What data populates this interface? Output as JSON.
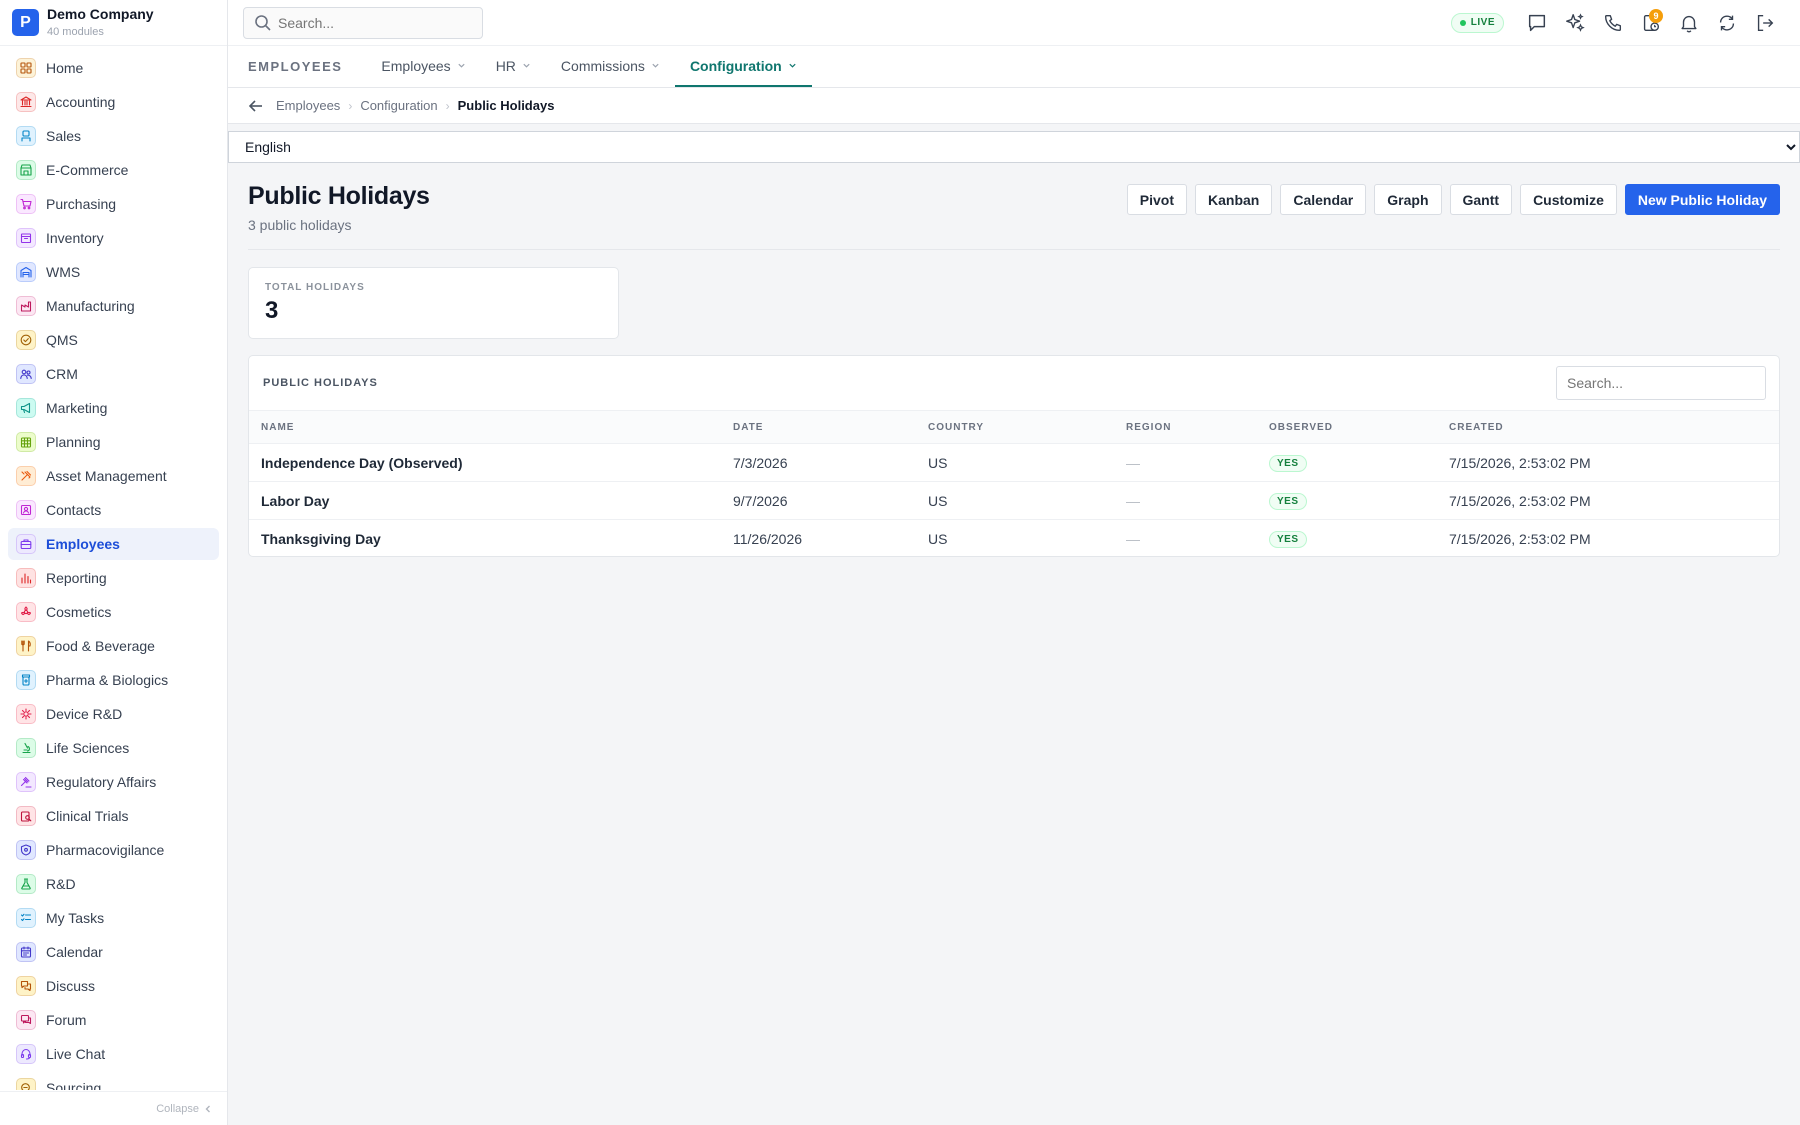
{
  "brand": {
    "logo_letter": "P",
    "name": "Demo Company",
    "subtitle": "40 modules"
  },
  "sidebar": {
    "items": [
      {
        "label": "Home",
        "icon": "grid-icon",
        "color": "#b45309",
        "bg": "#fdf3d8",
        "active": false
      },
      {
        "label": "Accounting",
        "icon": "bank-icon",
        "color": "#dc2626",
        "bg": "#fde8e8",
        "active": false
      },
      {
        "label": "Sales",
        "icon": "badge-icon",
        "color": "#0284c7",
        "bg": "#e0f2fe",
        "active": false
      },
      {
        "label": "E-Commerce",
        "icon": "store-icon",
        "color": "#16a34a",
        "bg": "#dcfce7",
        "active": false
      },
      {
        "label": "Purchasing",
        "icon": "cart-icon",
        "color": "#c026d3",
        "bg": "#fae8ff",
        "active": false
      },
      {
        "label": "Inventory",
        "icon": "box-icon",
        "color": "#9333ea",
        "bg": "#f3e8ff",
        "active": false
      },
      {
        "label": "WMS",
        "icon": "warehouse-icon",
        "color": "#2563eb",
        "bg": "#e0e7ff",
        "active": false
      },
      {
        "label": "Manufacturing",
        "icon": "factory-icon",
        "color": "#be185d",
        "bg": "#fce7f3",
        "active": false
      },
      {
        "label": "QMS",
        "icon": "check-circle-icon",
        "color": "#a16207",
        "bg": "#fef3c7",
        "active": false
      },
      {
        "label": "CRM",
        "icon": "users-icon",
        "color": "#4338ca",
        "bg": "#e0e7ff",
        "active": false
      },
      {
        "label": "Marketing",
        "icon": "megaphone-icon",
        "color": "#0d9488",
        "bg": "#ccfbf1",
        "active": false
      },
      {
        "label": "Planning",
        "icon": "calendar-grid-icon",
        "color": "#65a30d",
        "bg": "#ecfccb",
        "active": false
      },
      {
        "label": "Asset Management",
        "icon": "tools-icon",
        "color": "#ea580c",
        "bg": "#ffedd5",
        "active": false
      },
      {
        "label": "Contacts",
        "icon": "contact-card-icon",
        "color": "#c026d3",
        "bg": "#fae8ff",
        "active": false
      },
      {
        "label": "Employees",
        "icon": "briefcase-icon",
        "color": "#7c3aed",
        "bg": "#ede9fe",
        "active": true
      },
      {
        "label": "Reporting",
        "icon": "bar-chart-icon",
        "color": "#dc2626",
        "bg": "#fee2e2",
        "active": false
      },
      {
        "label": "Cosmetics",
        "icon": "flower-icon",
        "color": "#e11d48",
        "bg": "#ffe4e6",
        "active": false
      },
      {
        "label": "Food & Beverage",
        "icon": "utensils-icon",
        "color": "#b45309",
        "bg": "#fef3c7",
        "active": false
      },
      {
        "label": "Pharma & Biologics",
        "icon": "pill-bottle-icon",
        "color": "#0284c7",
        "bg": "#e0f2fe",
        "active": false
      },
      {
        "label": "Device R&D",
        "icon": "gear-chip-icon",
        "color": "#e11d48",
        "bg": "#ffe4e6",
        "active": false
      },
      {
        "label": "Life Sciences",
        "icon": "microscope-icon",
        "color": "#16a34a",
        "bg": "#dcfce7",
        "active": false
      },
      {
        "label": "Regulatory Affairs",
        "icon": "gavel-icon",
        "color": "#9333ea",
        "bg": "#f3e8ff",
        "active": false
      },
      {
        "label": "Clinical Trials",
        "icon": "clipboard-search-icon",
        "color": "#be123c",
        "bg": "#ffe4e6",
        "active": false
      },
      {
        "label": "Pharmacovigilance",
        "icon": "shield-icon",
        "color": "#4338ca",
        "bg": "#e0e7ff",
        "active": false
      },
      {
        "label": "R&D",
        "icon": "flask-icon",
        "color": "#16a34a",
        "bg": "#dcfce7",
        "active": false
      },
      {
        "label": "My Tasks",
        "icon": "checklist-icon",
        "color": "#0284c7",
        "bg": "#e0f2fe",
        "active": false
      },
      {
        "label": "Calendar",
        "icon": "calendar-icon",
        "color": "#4338ca",
        "bg": "#e0e7ff",
        "active": false
      },
      {
        "label": "Discuss",
        "icon": "chat-bubbles-icon",
        "color": "#b45309",
        "bg": "#fef3c7",
        "active": false
      },
      {
        "label": "Forum",
        "icon": "forum-icon",
        "color": "#be185d",
        "bg": "#fce7f3",
        "active": false
      },
      {
        "label": "Live Chat",
        "icon": "headset-icon",
        "color": "#7c3aed",
        "bg": "#ede9fe",
        "active": false
      },
      {
        "label": "Sourcing",
        "icon": "sourcing-icon",
        "color": "#a16207",
        "bg": "#fef3c7",
        "active": false
      }
    ],
    "collapse_label": "Collapse"
  },
  "topbar": {
    "search_placeholder": "Search...",
    "live_label": "LIVE",
    "notification_count": "9"
  },
  "module": {
    "label": "EMPLOYEES",
    "tabs": [
      {
        "label": "Employees",
        "active": false
      },
      {
        "label": "HR",
        "active": false
      },
      {
        "label": "Commissions",
        "active": false
      },
      {
        "label": "Configuration",
        "active": true
      }
    ]
  },
  "breadcrumb": {
    "items": [
      "Employees",
      "Configuration"
    ],
    "current": "Public Holidays"
  },
  "language": {
    "selected": "English"
  },
  "page": {
    "title": "Public Holidays",
    "subtitle": "3 public holidays",
    "actions": [
      "Pivot",
      "Kanban",
      "Calendar",
      "Graph",
      "Gantt",
      "Customize"
    ],
    "primary_action": "New Public Holiday"
  },
  "stats": {
    "label": "TOTAL HOLIDAYS",
    "value": "3"
  },
  "table": {
    "title": "PUBLIC HOLIDAYS",
    "search_placeholder": "Search...",
    "columns": [
      "NAME",
      "DATE",
      "COUNTRY",
      "REGION",
      "OBSERVED",
      "CREATED"
    ],
    "rows": [
      {
        "name": "Independence Day (Observed)",
        "date": "7/3/2026",
        "country": "US",
        "region": "—",
        "observed": "YES",
        "created": "7/15/2026, 2:53:02 PM"
      },
      {
        "name": "Labor Day",
        "date": "9/7/2026",
        "country": "US",
        "region": "—",
        "observed": "YES",
        "created": "7/15/2026, 2:53:02 PM"
      },
      {
        "name": "Thanksgiving Day",
        "date": "11/26/2026",
        "country": "US",
        "region": "—",
        "observed": "YES",
        "created": "7/15/2026, 2:53:02 PM"
      }
    ]
  },
  "colors": {
    "accent": "#2563eb",
    "teal": "#0f766e",
    "success": "#15803d"
  }
}
